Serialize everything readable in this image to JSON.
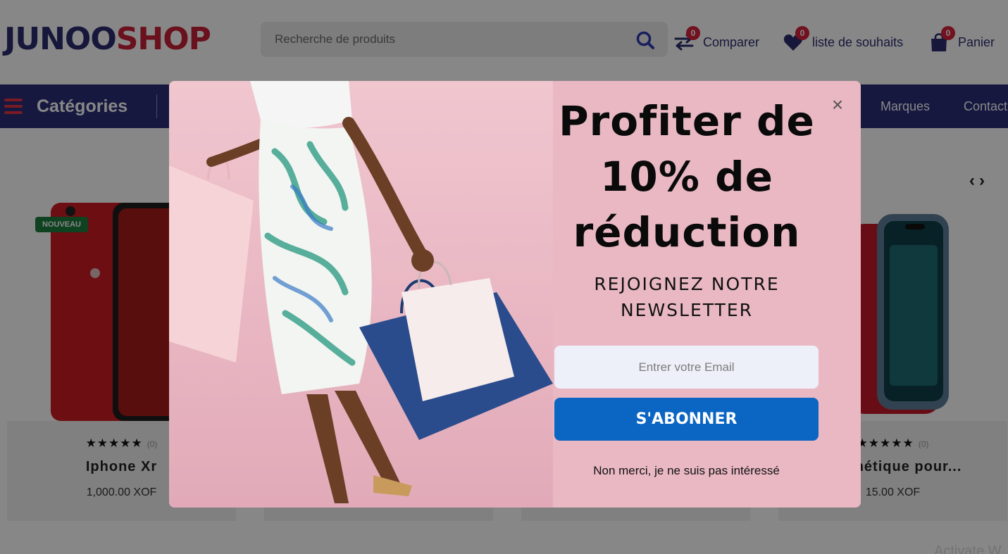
{
  "header": {
    "logo_part1": "JUNOO",
    "logo_part2": "SHOP",
    "search_placeholder": "Recherche de produits",
    "compare": {
      "label": "Comparer",
      "count": "0"
    },
    "wishlist": {
      "label": "liste de souhaits",
      "count": "0"
    },
    "cart": {
      "label": "Panier",
      "count": "0"
    }
  },
  "nav": {
    "categories_label": "Catégories",
    "links": [
      "Marques",
      "Contact"
    ]
  },
  "products": [
    {
      "name": "Iphone Xr",
      "rating_count": "(0)",
      "price": "1,000.00 XOF",
      "badge": "NOUVEAU"
    },
    {
      "name": "",
      "rating_count": "",
      "price": ""
    },
    {
      "name": "",
      "rating_count": "",
      "price": ""
    },
    {
      "name": "magnétique pour...",
      "rating_count": "(0)",
      "price": "15.00 XOF"
    }
  ],
  "stars": "★★★★★",
  "watermark": "Activate W",
  "popup": {
    "headline_line1": "Profiter de",
    "headline_line2": "10% de",
    "headline_line3": "réduction",
    "sub_line1": "REJOIGNEZ NOTRE",
    "sub_line2": "NEWSLETTER",
    "email_placeholder": "Entrer votre Email",
    "subscribe_label": "S'ABONNER",
    "decline_label": "Non merci, je ne suis pas intéressé",
    "close_symbol": "×"
  },
  "colors": {
    "brand_navy": "#2b2d6e",
    "brand_red": "#c8203a",
    "nav_bg": "#2b2f7a",
    "subscribe_blue": "#0a66c2",
    "popup_pink": "#ecbcc8"
  }
}
